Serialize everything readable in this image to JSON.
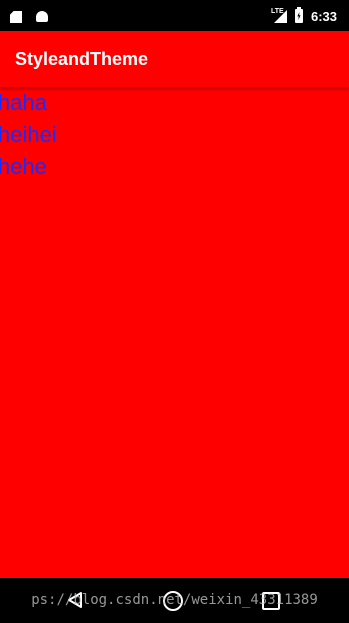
{
  "status_bar": {
    "time": "6:33",
    "network": "LTE",
    "icons": [
      "sd-card-icon",
      "android-debug-icon",
      "lte-signal-icon",
      "battery-charging-icon"
    ]
  },
  "app_bar": {
    "title": "StyleandTheme",
    "background_color": "#ff0000",
    "title_color": "#ffffff"
  },
  "content": {
    "background_color": "#ff0000",
    "text_color": "#1a2bff",
    "items": [
      "haha",
      "heihei",
      "hehe"
    ]
  },
  "nav_bar": {
    "icons": [
      "back-icon",
      "home-icon",
      "recents-icon"
    ]
  },
  "watermark": {
    "text": "ps://blog.csdn.net/weixin_43311389"
  }
}
